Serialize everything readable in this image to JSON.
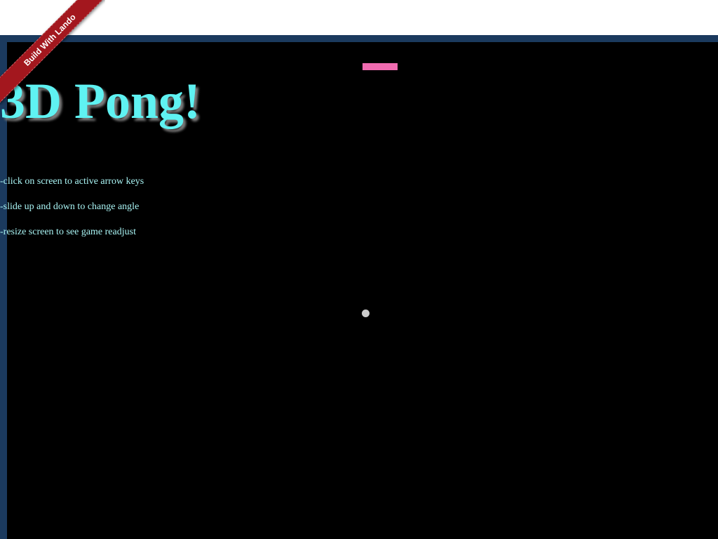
{
  "ribbon": {
    "label": "Build With Lando",
    "color": "#a3171e"
  },
  "game": {
    "title": "3D Pong!",
    "instructions": [
      "-click on screen to active arrow keys",
      "-slide up and down to change angle",
      "-resize screen to see game readjust"
    ]
  },
  "colors": {
    "title": "#5ff2f2",
    "instructions": "#a9f4f4",
    "paddle": "#f06bb0",
    "ball": "#cccccc",
    "background": "#000000",
    "frame": "#1b3a5e"
  }
}
